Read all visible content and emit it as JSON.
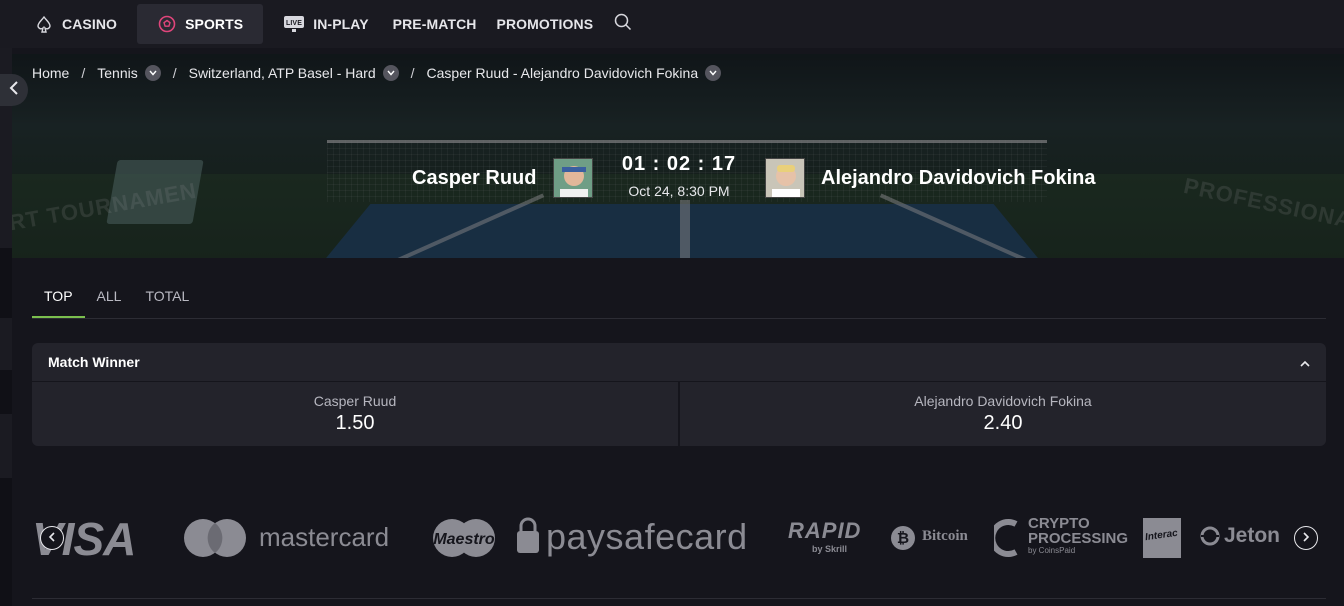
{
  "nav": {
    "casino": "CASINO",
    "sports": "SPORTS",
    "inplay": "IN-PLAY",
    "inplay_badge": "LIVE",
    "prematch": "PRE-MATCH",
    "promotions": "PROMOTIONS",
    "icons": {
      "casino": "spade-icon",
      "sports": "soccer-ball-icon",
      "inplay": "live-tv-icon",
      "search": "search-icon"
    }
  },
  "breadcrumb": {
    "home": "Home",
    "sport": "Tennis",
    "tournament": "Switzerland, ATP Basel - Hard",
    "event": "Casper Ruud - Alejandro Davidovich Fokina",
    "separator": "/"
  },
  "event": {
    "home_player": "Casper Ruud",
    "away_player": "Alejandro Davidovich Fokina",
    "countdown": "01 : 02 : 17",
    "kickoff": "Oct 24, 8:30 PM"
  },
  "hero_signage": {
    "left": "RT TOURNAMEN",
    "right": "PROFESSIONAL"
  },
  "tabs": [
    "TOP",
    "ALL",
    "TOTAL"
  ],
  "active_tab": "TOP",
  "market": {
    "title": "Match Winner",
    "outcomes": [
      {
        "name": "Casper Ruud",
        "odds": "1.50"
      },
      {
        "name": "Alejandro Davidovich Fokina",
        "odds": "2.40"
      }
    ]
  },
  "payments": {
    "visa": "VISA",
    "mastercard": "mastercard",
    "maestro": "Maestro",
    "paysafecard": "paysafecard",
    "rapid": "RAPID",
    "rapid_sub": "by Skrill",
    "bitcoin": "Bitcoin",
    "crypto": "CRYPTO",
    "crypto_line2": "PROCESSING",
    "crypto_sub": "by CoinsPaid",
    "interac": "Interac",
    "jeton": "Jeton"
  },
  "colors": {
    "accent_tab": "#7bbf4e",
    "sports_icon": "#e0457b",
    "panel": "#23232b",
    "background": "#15151c"
  }
}
